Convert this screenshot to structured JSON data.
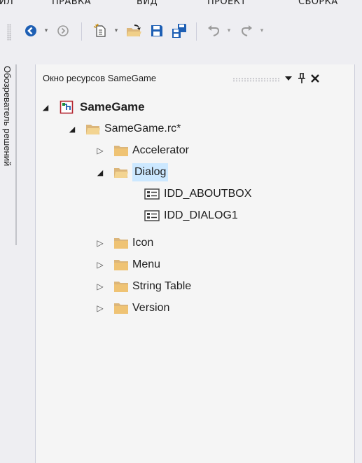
{
  "menubar": {
    "items": [
      "ФАЙЛ",
      "ПРАВКА",
      "ВИД",
      "ПРОЕКТ",
      "СБОРКА"
    ]
  },
  "toolbar": {
    "icons": [
      "back-icon",
      "forward-icon",
      "new-project-icon",
      "open-file-icon",
      "save-icon",
      "save-all-icon",
      "undo-icon",
      "redo-icon"
    ]
  },
  "side_tab": {
    "label": "Обозреватель решений"
  },
  "panel": {
    "title": "Окно ресурсов SameGame",
    "buttons": [
      "dropdown-icon",
      "pin-icon",
      "close-icon"
    ]
  },
  "tree": {
    "root": "SameGame",
    "rc_file": "SameGame.rc*",
    "accelerator": "Accelerator",
    "dialog": "Dialog",
    "dialog_children": [
      "IDD_ABOUTBOX",
      "IDD_DIALOG1"
    ],
    "icon": "Icon",
    "menu": "Menu",
    "string_table": "String Table",
    "version": "Version"
  },
  "colors": {
    "folder": "#dcb67a",
    "selection": "#cce8ff",
    "nav_blue": "#1e5fb4",
    "background": "#eeeef2"
  }
}
